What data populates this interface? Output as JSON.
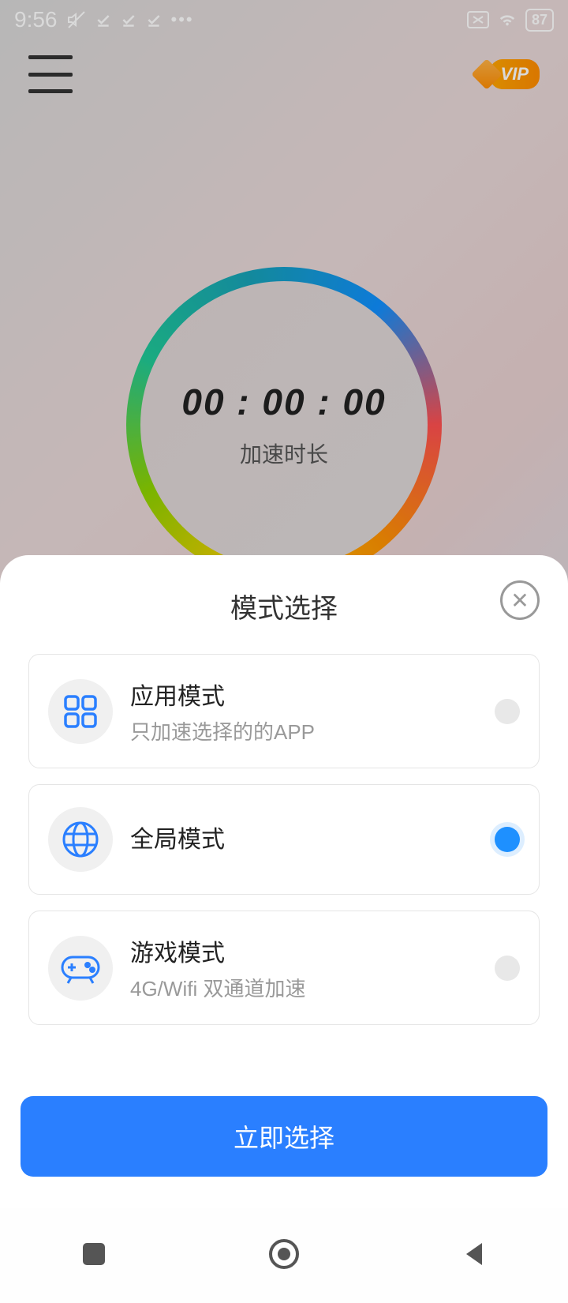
{
  "status": {
    "time": "9:56",
    "battery": "87"
  },
  "header": {
    "vip_label": "VIP"
  },
  "timer": {
    "display": "00 : 00 : 00",
    "label": "加速时长"
  },
  "sheet": {
    "title": "模式选择",
    "close_symbol": "✕",
    "modes": [
      {
        "title": "应用模式",
        "subtitle": "只加速选择的的APP",
        "selected": false
      },
      {
        "title": "全局模式",
        "subtitle": "",
        "selected": true
      },
      {
        "title": "游戏模式",
        "subtitle": "4G/Wifi 双通道加速",
        "selected": false
      }
    ],
    "confirm_label": "立即选择"
  }
}
